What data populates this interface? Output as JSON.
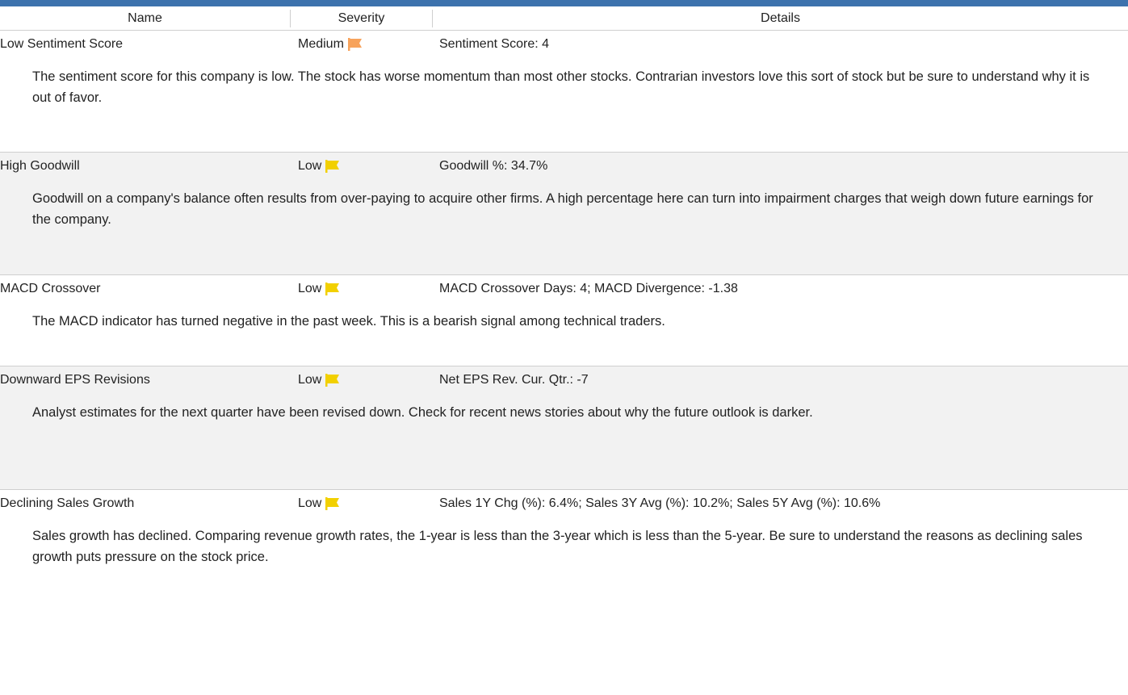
{
  "header": {
    "name": "Name",
    "severity": "Severity",
    "details": "Details"
  },
  "colors": {
    "accent": "#3d72ad",
    "flag_medium": "#f7a35c",
    "flag_low": "#f2d000"
  },
  "rows": [
    {
      "name": "Low Sentiment Score",
      "severity": "Medium",
      "flag_icon": "orange-flag-icon",
      "details": "Sentiment Score: 4",
      "description": "The sentiment score for this company is low. The stock has worse momentum than most other stocks. Contrarian investors love this sort of stock but be sure to understand why it is out of favor."
    },
    {
      "name": "High Goodwill",
      "severity": "Low",
      "flag_icon": "yellow-flag-icon",
      "details": "Goodwill %: 34.7%",
      "description": "Goodwill on a company's balance often results from over-paying to acquire other firms. A high percentage here can turn into impairment charges that weigh down future earnings for the company."
    },
    {
      "name": "MACD Crossover",
      "severity": "Low",
      "flag_icon": "yellow-flag-icon",
      "details": "MACD Crossover Days: 4;  MACD Divergence: -1.38",
      "description": "The MACD indicator has turned negative in the past week. This is a bearish signal among technical traders."
    },
    {
      "name": "Downward EPS Revisions",
      "severity": "Low",
      "flag_icon": "yellow-flag-icon",
      "details": "Net EPS Rev. Cur. Qtr.: -7",
      "description": "Analyst estimates for the next quarter have been revised down. Check for recent news stories about why the future outlook is darker."
    },
    {
      "name": "Declining Sales Growth",
      "severity": "Low",
      "flag_icon": "yellow-flag-icon",
      "details": "Sales 1Y Chg (%): 6.4%;  Sales 3Y Avg (%): 10.2%;  Sales 5Y Avg (%): 10.6%",
      "description": "Sales growth has declined. Comparing revenue growth rates, the 1-year is less than the 3-year which is less than the 5-year. Be sure to understand the reasons as declining sales growth puts pressure on the stock price."
    }
  ]
}
